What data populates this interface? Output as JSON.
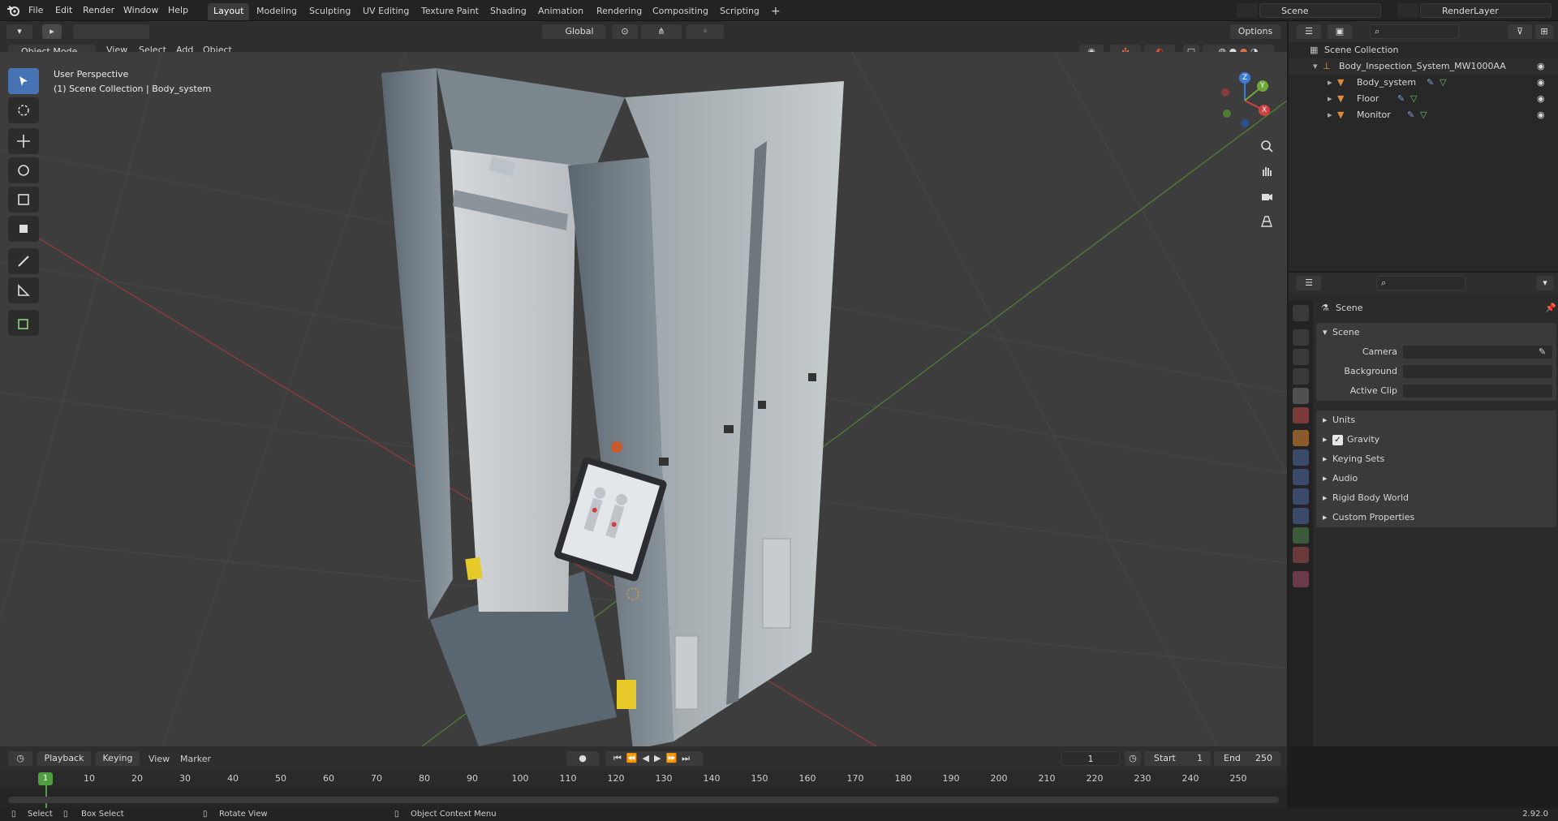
{
  "topbar": {
    "menus": [
      "File",
      "Edit",
      "Render",
      "Window",
      "Help"
    ],
    "workspaces": [
      "Layout",
      "Modeling",
      "Sculpting",
      "UV Editing",
      "Texture Paint",
      "Shading",
      "Animation",
      "Rendering",
      "Compositing",
      "Scripting"
    ],
    "active_workspace": "Layout",
    "add_tab": "+",
    "scene": "Scene",
    "view_layer": "RenderLayer"
  },
  "viewport_header": {
    "orientation": "Global",
    "options": "Options",
    "mode": "Object Mode",
    "menus": [
      "View",
      "Select",
      "Add",
      "Object"
    ]
  },
  "viewport": {
    "overlay_line1": "User Perspective",
    "overlay_line2": "(1) Scene Collection | Body_system",
    "gizmo_axes": [
      "X",
      "Y",
      "Z"
    ],
    "colors": {
      "x_axis": "#d24043",
      "y_axis": "#6ea83a",
      "z_axis": "#3b7bd6",
      "active_tool": "#4772b3"
    },
    "tools": [
      "select-box-icon",
      "cursor-icon",
      "move-icon",
      "rotate-icon",
      "scale-icon",
      "transform-icon",
      "annotate-icon",
      "measure-icon",
      "add-cube-icon"
    ]
  },
  "outliner": {
    "root": "Scene Collection",
    "collection": "Body_Inspection_System_MW1000AA",
    "objects": [
      "Body_system",
      "Floor",
      "Monitor"
    ]
  },
  "properties": {
    "context": "Scene",
    "panel_title": "Scene",
    "fields": [
      {
        "label": "Camera",
        "value": ""
      },
      {
        "label": "Background Scene",
        "value": ""
      },
      {
        "label": "Active Clip",
        "value": ""
      }
    ],
    "subpanels": [
      "Units",
      "Gravity",
      "Keying Sets",
      "Audio",
      "Rigid Body World",
      "Custom Properties"
    ],
    "gravity_checked": true
  },
  "timeline": {
    "menus": [
      "Playback",
      "Keying",
      "View",
      "Marker"
    ],
    "current_frame": "1",
    "start_label": "Start",
    "start": "1",
    "end_label": "End",
    "end": "250",
    "ruler": [
      "10",
      "20",
      "30",
      "40",
      "50",
      "60",
      "70",
      "80",
      "90",
      "100",
      "110",
      "120",
      "130",
      "140",
      "150",
      "160",
      "170",
      "180",
      "190",
      "200",
      "210",
      "220",
      "230",
      "240",
      "250"
    ],
    "playhead": "1"
  },
  "statusbar": {
    "items": [
      "Select",
      "Box Select",
      "Rotate View",
      "Object Context Menu"
    ],
    "version": "2.92.0"
  }
}
